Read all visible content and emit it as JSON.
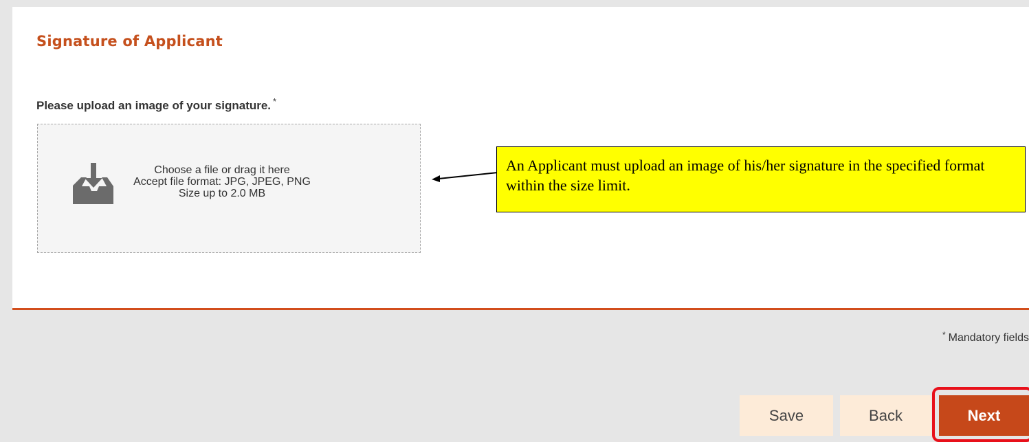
{
  "section": {
    "title": "Signature of Applicant"
  },
  "signature_field": {
    "label": "Please upload an image of your signature.",
    "required_marker": "*"
  },
  "upload": {
    "icon": "tray-download-icon",
    "line1": "Choose a file or drag it here",
    "line2": "Accept file format: JPG, JPEG, PNG",
    "line3": "Size up to 2.0 MB"
  },
  "callout": {
    "text": "An Applicant must upload an image of his/her signature in the specified format within the size limit."
  },
  "footer": {
    "mandatory_marker": "*",
    "mandatory_note": "Mandatory fields"
  },
  "buttons": {
    "save": "Save",
    "back": "Back",
    "next": "Next"
  },
  "colors": {
    "accent": "#c5501d",
    "next_button": "#c6481a",
    "secondary_button": "#fdebd8",
    "callout_background": "#ffff00",
    "highlight_border": "#e8101a",
    "page_background": "#e6e6e6"
  }
}
